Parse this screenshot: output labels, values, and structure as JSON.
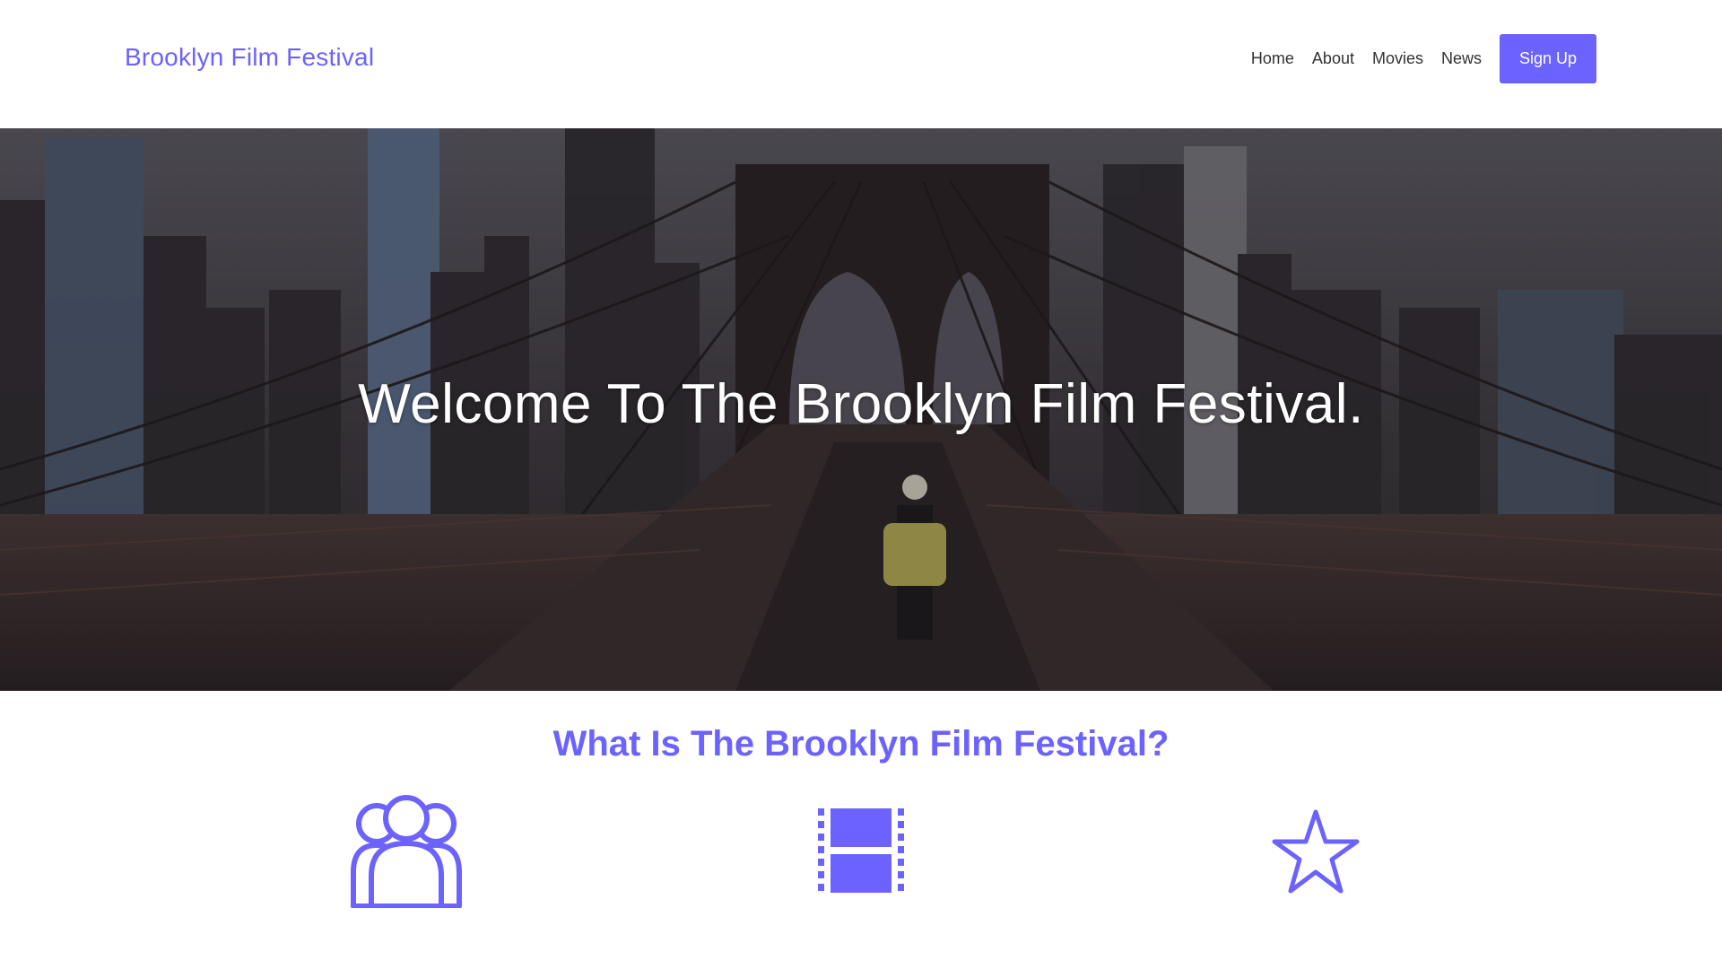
{
  "header": {
    "logo": "Brooklyn Film Festival",
    "nav": [
      {
        "label": "Home"
      },
      {
        "label": "About"
      },
      {
        "label": "Movies"
      },
      {
        "label": "News"
      }
    ],
    "cta_label": "Sign Up"
  },
  "hero": {
    "title": "Welcome To The Brooklyn Film Festival.",
    "image": "brooklyn-bridge-photo"
  },
  "about": {
    "title": "What Is The Brooklyn Film Festival?",
    "icons": [
      "users-icon",
      "film-icon",
      "star-icon"
    ]
  },
  "colors": {
    "accent": "#6c63ff",
    "nav_text": "#333333",
    "hero_overlay": "#2a2729"
  }
}
